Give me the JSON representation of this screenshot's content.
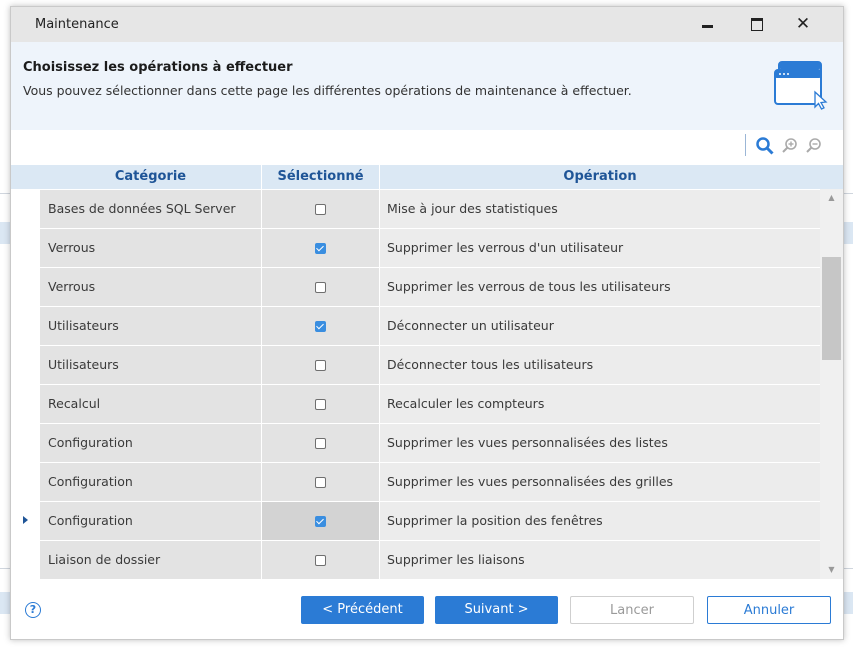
{
  "window": {
    "title": "Maintenance",
    "minimize_label": "",
    "maximize_label": "",
    "close_label": "✕"
  },
  "header": {
    "title": "Choisissez les opérations à effectuer",
    "subtitle": "Vous pouvez sélectionner dans cette page les différentes opérations de maintenance à effectuer."
  },
  "grid": {
    "columns": [
      "Catégorie",
      "Sélectionné",
      "Opération"
    ],
    "rows": [
      {
        "category": "Bases de données SQL Server",
        "selected": false,
        "operation": "Mise à jour des statistiques"
      },
      {
        "category": "Verrous",
        "selected": true,
        "operation": "Supprimer les verrous d'un utilisateur"
      },
      {
        "category": "Verrous",
        "selected": false,
        "operation": "Supprimer les verrous de tous les utilisateurs"
      },
      {
        "category": "Utilisateurs",
        "selected": true,
        "operation": "Déconnecter un utilisateur"
      },
      {
        "category": "Utilisateurs",
        "selected": false,
        "operation": "Déconnecter tous les utilisateurs"
      },
      {
        "category": "Recalcul",
        "selected": false,
        "operation": "Recalculer les compteurs"
      },
      {
        "category": "Configuration",
        "selected": false,
        "operation": "Supprimer les vues personnalisées des listes"
      },
      {
        "category": "Configuration",
        "selected": false,
        "operation": "Supprimer les vues personnalisées des grilles"
      },
      {
        "category": "Configuration",
        "selected": true,
        "operation": "Supprimer la position des fenêtres",
        "current": true
      },
      {
        "category": "Liaison de dossier",
        "selected": false,
        "operation": "Supprimer les liaisons"
      }
    ]
  },
  "footer": {
    "help_label": "?",
    "prev_label": "< Précédent",
    "next_label": "Suivant >",
    "lancer_label": "Lancer",
    "annuler_label": "Annuler"
  },
  "colors": {
    "accent": "#2b7bd5",
    "header_text": "#1f5597",
    "checked": "#3a8ee0"
  },
  "icons": {
    "toolbar": [
      "search-icon",
      "zoom-in-icon",
      "zoom-out-icon"
    ],
    "header": "window-cursor-icon"
  }
}
